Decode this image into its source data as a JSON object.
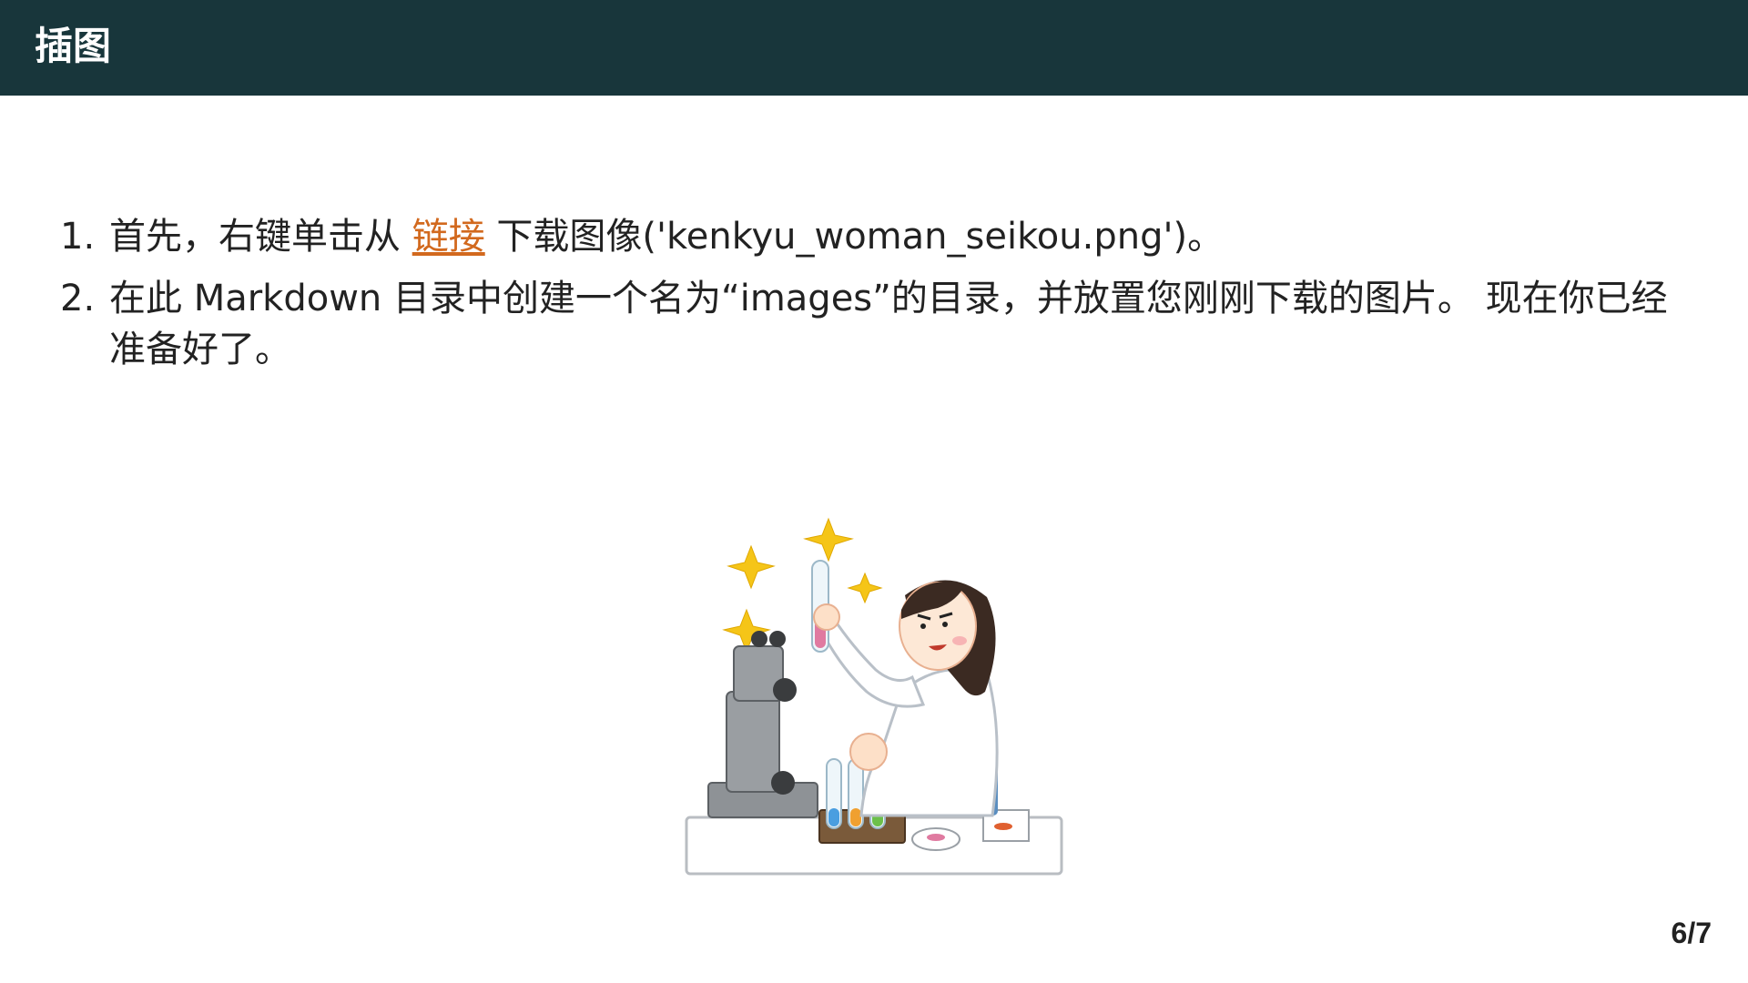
{
  "slide": {
    "title": "插图",
    "page": "6/7"
  },
  "steps": [
    {
      "number": "1.",
      "before_link": "首先，右键单击从 ",
      "link_text": "链接",
      "after_link": " 下载图像('kenkyu_woman_seikou.png')。"
    },
    {
      "number": "2.",
      "text": "在此 Markdown 目录中创建一个名为“images”的目录，并放置您刚刚下载的图片。 现在你已经准备好了。"
    }
  ],
  "colors": {
    "header_bg": "#18363b",
    "link": "#d2691e",
    "text": "#222222"
  },
  "illustration": {
    "icon": "scientist-woman-success-illustration"
  }
}
